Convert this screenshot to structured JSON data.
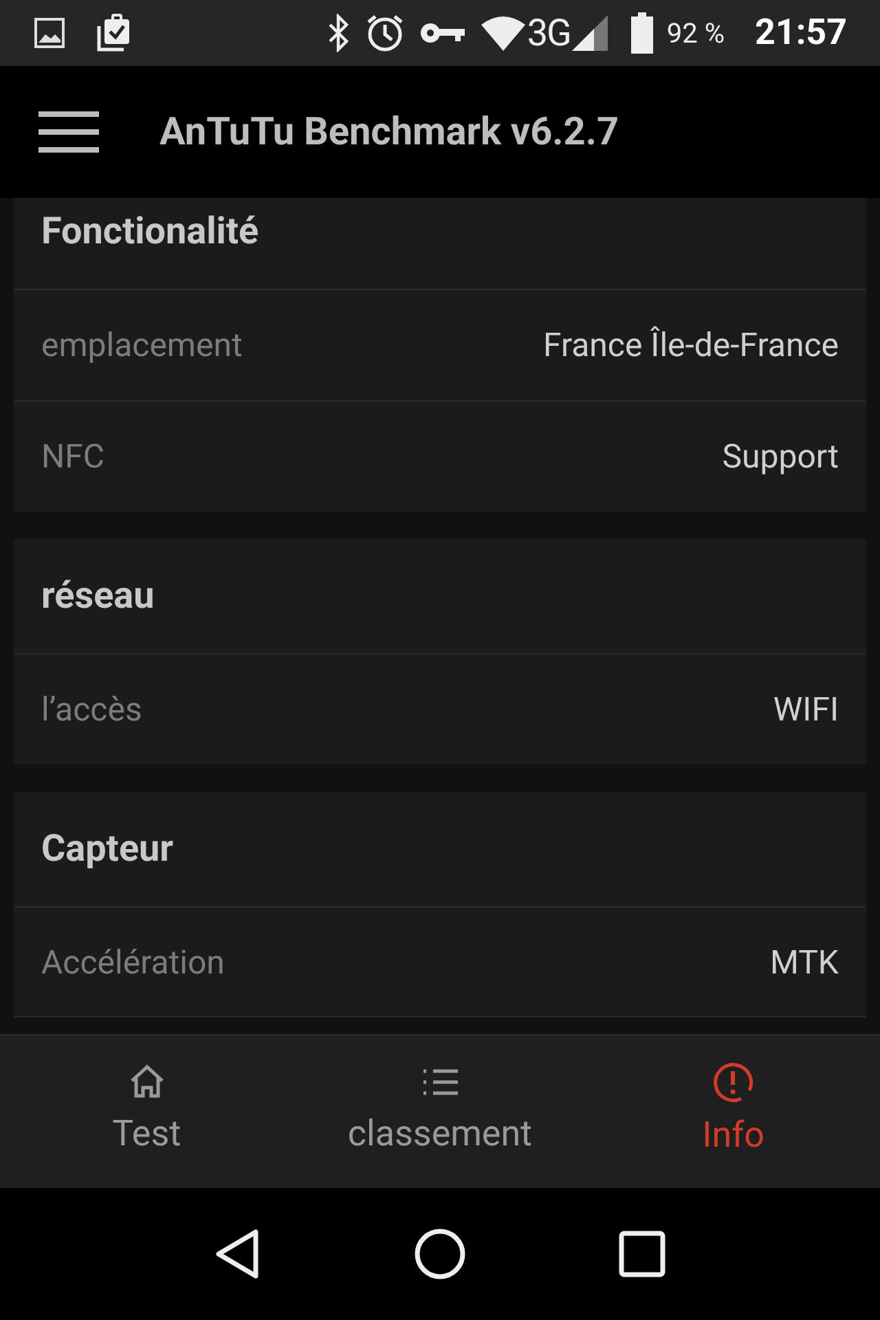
{
  "status_bar": {
    "network": "3G",
    "battery": "92 %",
    "time": "21:57"
  },
  "app_bar": {
    "title": "AnTuTu Benchmark v6.2.7"
  },
  "sections": [
    {
      "title": "Fonctionalité",
      "rows": [
        {
          "label": "emplacement",
          "value": "France Île-de-France"
        },
        {
          "label": "NFC",
          "value": "Support"
        }
      ]
    },
    {
      "title": "réseau",
      "rows": [
        {
          "label": "l’accès",
          "value": "WIFI"
        }
      ]
    },
    {
      "title": "Capteur",
      "rows": [
        {
          "label": "Accélération",
          "value": "MTK"
        }
      ]
    }
  ],
  "bottom_nav": [
    {
      "kind": "home",
      "label": "Test",
      "selected": false
    },
    {
      "kind": "list",
      "label": "classement",
      "selected": false
    },
    {
      "kind": "info",
      "label": "Info",
      "selected": true
    }
  ]
}
